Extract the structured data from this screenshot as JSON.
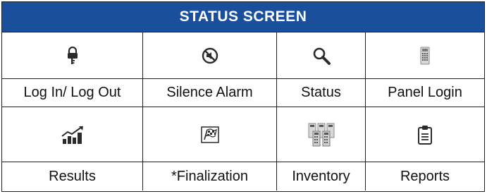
{
  "title": "STATUS SCREEN",
  "colors": {
    "header_bg": "#1a4f9c",
    "header_text": "#ffffff",
    "border": "#1f1f1f",
    "icon": "#2b2b2b"
  },
  "rows": [
    {
      "items": [
        {
          "label": "Log In/ Log Out",
          "icon": "lock-key-icon"
        },
        {
          "label": "Silence Alarm",
          "icon": "muted-speaker-icon"
        },
        {
          "label": "Status",
          "icon": "magnifier-icon"
        },
        {
          "label": "Panel Login",
          "icon": "panel-device-icon"
        }
      ]
    },
    {
      "items": [
        {
          "label": "Results",
          "icon": "trend-chart-icon"
        },
        {
          "label": "*Finalization",
          "icon": "checkered-flag-icon"
        },
        {
          "label": "Inventory",
          "icon": "device-stack-icon"
        },
        {
          "label": "Reports",
          "icon": "clipboard-report-icon"
        }
      ]
    }
  ]
}
